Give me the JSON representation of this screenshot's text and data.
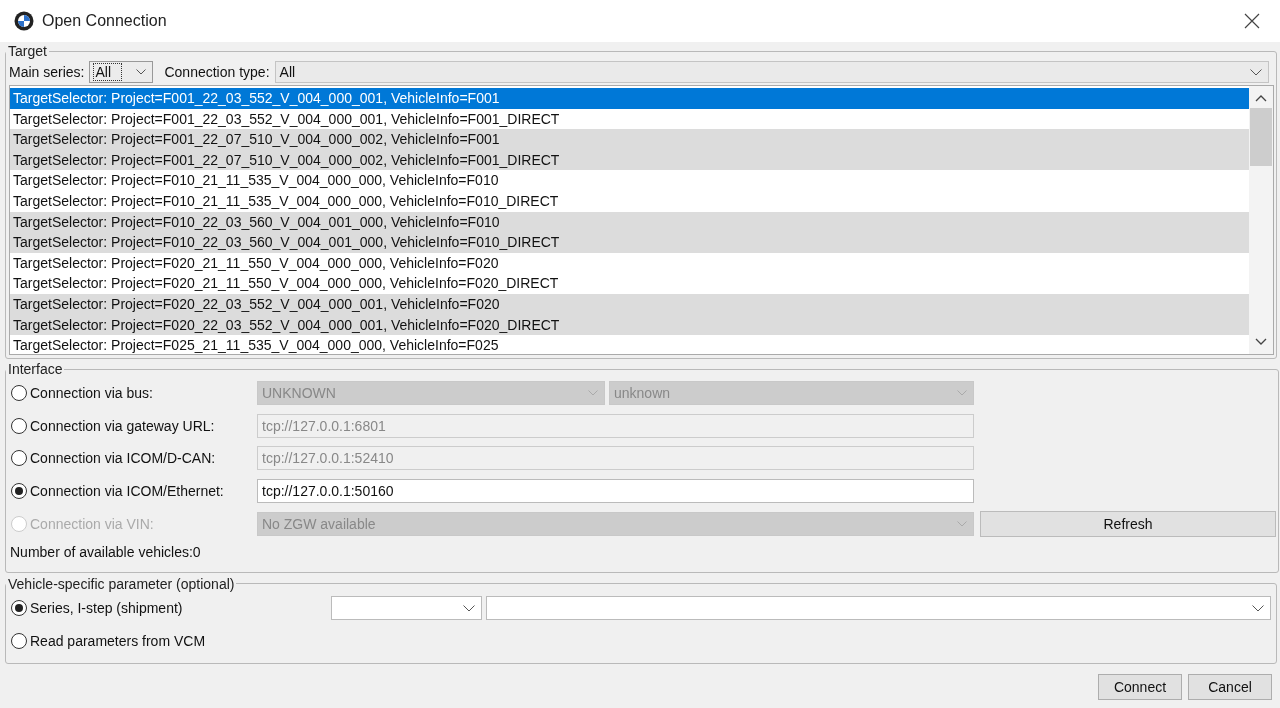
{
  "window": {
    "title": "Open Connection"
  },
  "target": {
    "legend": "Target",
    "main_series_label": "Main series:",
    "main_series_value": "All",
    "connection_type_label": "Connection type:",
    "connection_type_value": "All",
    "rows": [
      {
        "text": "TargetSelector: Project=F001_22_03_552_V_004_000_001, VehicleInfo=F001",
        "selected": true,
        "shaded": false
      },
      {
        "text": "TargetSelector: Project=F001_22_03_552_V_004_000_001, VehicleInfo=F001_DIRECT",
        "selected": false,
        "shaded": false
      },
      {
        "text": "TargetSelector: Project=F001_22_07_510_V_004_000_002, VehicleInfo=F001",
        "selected": false,
        "shaded": true
      },
      {
        "text": "TargetSelector: Project=F001_22_07_510_V_004_000_002, VehicleInfo=F001_DIRECT",
        "selected": false,
        "shaded": true
      },
      {
        "text": "TargetSelector: Project=F010_21_11_535_V_004_000_000, VehicleInfo=F010",
        "selected": false,
        "shaded": false
      },
      {
        "text": "TargetSelector: Project=F010_21_11_535_V_004_000_000, VehicleInfo=F010_DIRECT",
        "selected": false,
        "shaded": false
      },
      {
        "text": "TargetSelector: Project=F010_22_03_560_V_004_001_000, VehicleInfo=F010",
        "selected": false,
        "shaded": true
      },
      {
        "text": "TargetSelector: Project=F010_22_03_560_V_004_001_000, VehicleInfo=F010_DIRECT",
        "selected": false,
        "shaded": true
      },
      {
        "text": "TargetSelector: Project=F020_21_11_550_V_004_000_000, VehicleInfo=F020",
        "selected": false,
        "shaded": false
      },
      {
        "text": "TargetSelector: Project=F020_21_11_550_V_004_000_000, VehicleInfo=F020_DIRECT",
        "selected": false,
        "shaded": false
      },
      {
        "text": "TargetSelector: Project=F020_22_03_552_V_004_000_001, VehicleInfo=F020",
        "selected": false,
        "shaded": true
      },
      {
        "text": "TargetSelector: Project=F020_22_03_552_V_004_000_001, VehicleInfo=F020_DIRECT",
        "selected": false,
        "shaded": true
      },
      {
        "text": "TargetSelector: Project=F025_21_11_535_V_004_000_000, VehicleInfo=F025",
        "selected": false,
        "shaded": false
      }
    ]
  },
  "interface": {
    "legend": "Interface",
    "options": [
      {
        "kind": "select2",
        "label": "Connection via bus:",
        "selected": false,
        "disabled": false,
        "value": "UNKNOWN",
        "value2": "unknown",
        "field_disabled": true
      },
      {
        "kind": "text",
        "label": "Connection via gateway URL:",
        "selected": false,
        "disabled": false,
        "value": "tcp://127.0.0.1:6801",
        "field_disabled": true
      },
      {
        "kind": "text",
        "label": "Connection via ICOM/D-CAN:",
        "selected": false,
        "disabled": false,
        "value": "tcp://127.0.0.1:52410",
        "field_disabled": true
      },
      {
        "kind": "text",
        "label": "Connection via ICOM/Ethernet:",
        "selected": true,
        "disabled": false,
        "value": "tcp://127.0.0.1:50160",
        "field_disabled": false
      },
      {
        "kind": "select_button",
        "label": "Connection via VIN:",
        "selected": false,
        "disabled": true,
        "value": "No ZGW available",
        "button": "Refresh",
        "field_disabled": true
      }
    ],
    "vehicles_count": "Number of available vehicles:0"
  },
  "vehicle_params": {
    "legend": "Vehicle-specific parameter (optional)",
    "options": [
      {
        "kind": "selects",
        "label": "Series, I-step (shipment)",
        "selected": true
      },
      {
        "kind": "plain",
        "label": "Read parameters from VCM",
        "selected": false
      }
    ]
  },
  "buttons": [
    "Connect",
    "Cancel"
  ]
}
